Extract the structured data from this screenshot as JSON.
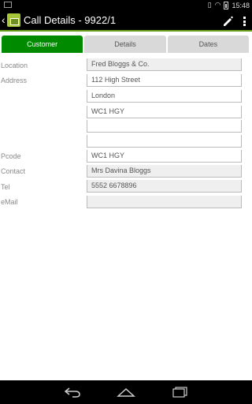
{
  "status": {
    "time": "15:48",
    "icons": [
      "screenshot-icon",
      "vibrate-icon",
      "wifi-icon",
      "battery-icon"
    ]
  },
  "header": {
    "title": "Call Details - 9922/1",
    "icons": [
      "back-icon",
      "app-icon",
      "edit-pencil-icon",
      "overflow-menu-icon"
    ]
  },
  "tabs": [
    {
      "label": "Customer",
      "active": true
    },
    {
      "label": "Details",
      "active": false
    },
    {
      "label": "Dates",
      "active": false
    }
  ],
  "form": {
    "location_label": "Location",
    "location_value": "Fred Bloggs & Co.",
    "address_label": "Address",
    "address_line1": "112 High Street",
    "address_line2": "London",
    "address_line3": "WC1 HGY",
    "address_line4": "",
    "address_line5": "",
    "pcode_label": "Pcode",
    "pcode_value": "WC1 HGY",
    "contact_label": "Contact",
    "contact_value": "Mrs Davina Bloggs",
    "tel_label": "Tel",
    "tel_value": "5552 6678896",
    "email_label": "eMail",
    "email_value": ""
  },
  "navbar": {
    "icons": [
      "nav-back-icon",
      "nav-home-icon",
      "nav-recents-icon"
    ]
  },
  "colors": {
    "accent": "#6aa21e",
    "active_tab": "#008a00",
    "inactive_tab": "#d9d9d9"
  }
}
